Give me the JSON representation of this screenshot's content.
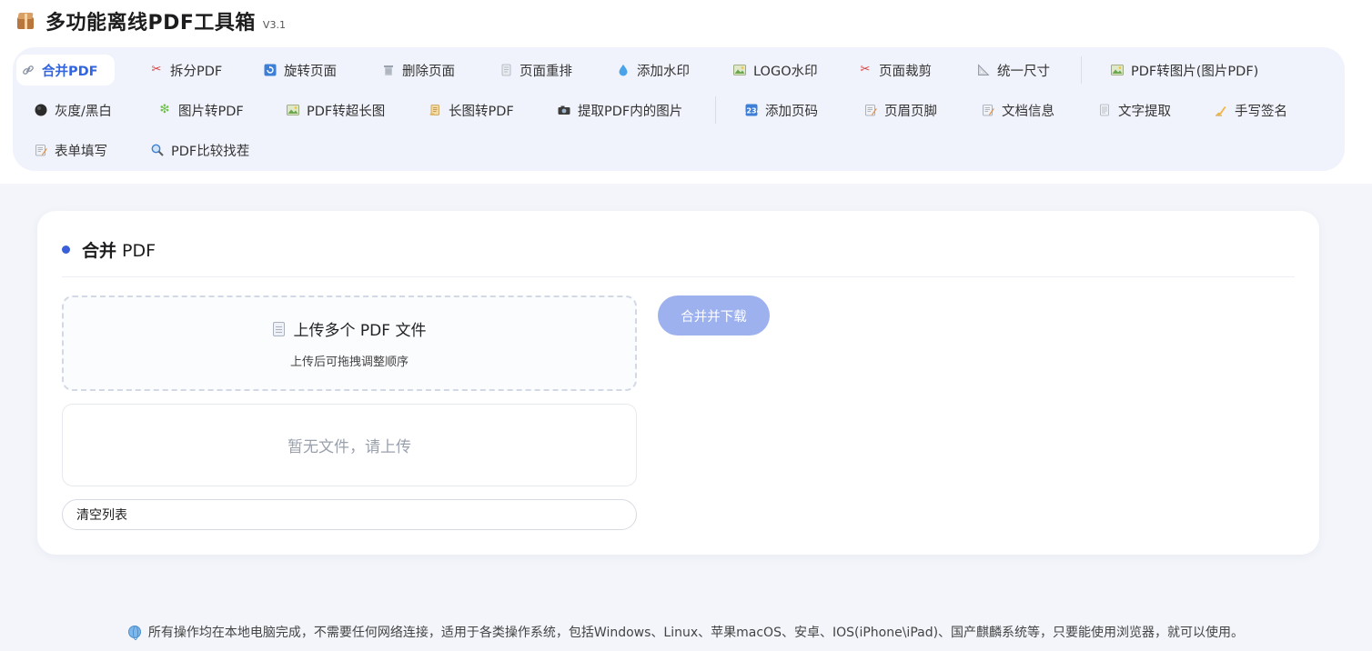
{
  "app": {
    "title": "多功能离线PDF工具箱",
    "version": "V3.1"
  },
  "toolbar": {
    "items": [
      {
        "label": "合并PDF",
        "icon": "link-icon",
        "active": true
      },
      {
        "label": "拆分PDF",
        "icon": "scissors-icon"
      },
      {
        "label": "旋转页面",
        "icon": "rotate-icon"
      },
      {
        "label": "删除页面",
        "icon": "trash-icon"
      },
      {
        "label": "页面重排",
        "icon": "pages-icon"
      },
      {
        "label": "添加水印",
        "icon": "droplet-icon"
      },
      {
        "label": "LOGO水印",
        "icon": "image-icon"
      },
      {
        "label": "页面裁剪",
        "icon": "scissors-icon"
      },
      {
        "label": "统一尺寸",
        "icon": "ruler-icon"
      },
      {
        "label": "PDF转图片(图片PDF)",
        "icon": "image-icon"
      },
      {
        "label": "灰度/黑白",
        "icon": "circle-icon"
      },
      {
        "label": "图片转PDF",
        "icon": "sparkle-icon"
      },
      {
        "label": "PDF转超长图",
        "icon": "image-icon"
      },
      {
        "label": "长图转PDF",
        "icon": "scroll-icon"
      },
      {
        "label": "提取PDF内的图片",
        "icon": "camera-icon"
      },
      {
        "label": "添加页码",
        "icon": "numbers-icon"
      },
      {
        "label": "页眉页脚",
        "icon": "memo-icon"
      },
      {
        "label": "文档信息",
        "icon": "memo-icon"
      },
      {
        "label": "文字提取",
        "icon": "text-doc-icon"
      },
      {
        "label": "手写签名",
        "icon": "writing-hand-icon"
      },
      {
        "label": "表单填写",
        "icon": "memo-icon"
      },
      {
        "label": "PDF比较找茬",
        "icon": "magnifier-icon"
      }
    ]
  },
  "panel": {
    "title_bold": "合并",
    "title_rest": " PDF",
    "upload_title": "上传多个 PDF 文件",
    "upload_hint": "上传后可拖拽调整顺序",
    "empty_text": "暂无文件，请上传",
    "clear_label": "清空列表",
    "merge_label": "合并并下载"
  },
  "footer": {
    "text": "所有操作均在本地电脑完成，不需要任何网络连接，适用于各类操作系统，包括Windows、Linux、苹果macOS、安卓、IOS(iPhone\\iPad)、国产麒麟系统等，只要能使用浏览器，就可以使用。"
  },
  "colors": {
    "accent": "#3465e0",
    "merge_button": "#9db1ee",
    "toolbar_bg": "#f0f3fb",
    "page_bg": "#f3f5fa"
  }
}
